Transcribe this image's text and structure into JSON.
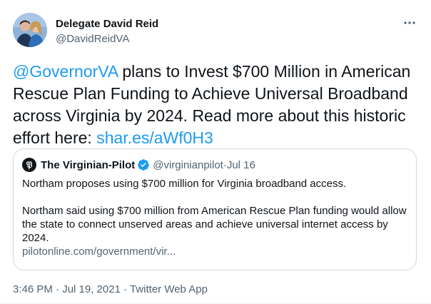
{
  "author": {
    "display_name": "Delegate David Reid",
    "handle": "@DavidReidVA"
  },
  "tweet": {
    "mention": "@GovernorVA",
    "text": " plans to Invest $700 Million in American Rescue Plan Funding to Achieve Universal Broadband across Virginia by 2024. Read more about this historic effort here: ",
    "link": "shar.es/aWf0H3"
  },
  "quote": {
    "name": "The Virginian-Pilot",
    "handle": "@virginianpilot",
    "separator": " · ",
    "date": "Jul 16",
    "headline": "Northam proposes using $700 million for Virginia broadband access.",
    "summary": "Northam said using $700 million from American Rescue Plan funding would allow the state to connect unserved areas and achieve universal internet access by 2024.",
    "url": "pilotonline.com/government/vir..."
  },
  "footer": {
    "timestamp": "3:46 PM · Jul 19, 2021 · Twitter Web App"
  },
  "colors": {
    "link": "#1d9bf0",
    "secondary_text": "#536471",
    "primary_text": "#0f1419",
    "verified": "#1d9bf0"
  },
  "icons": {
    "more": "more-horizontal-icon",
    "verified": "verified-badge-icon",
    "quote_logo": "virginian-pilot-logo"
  }
}
